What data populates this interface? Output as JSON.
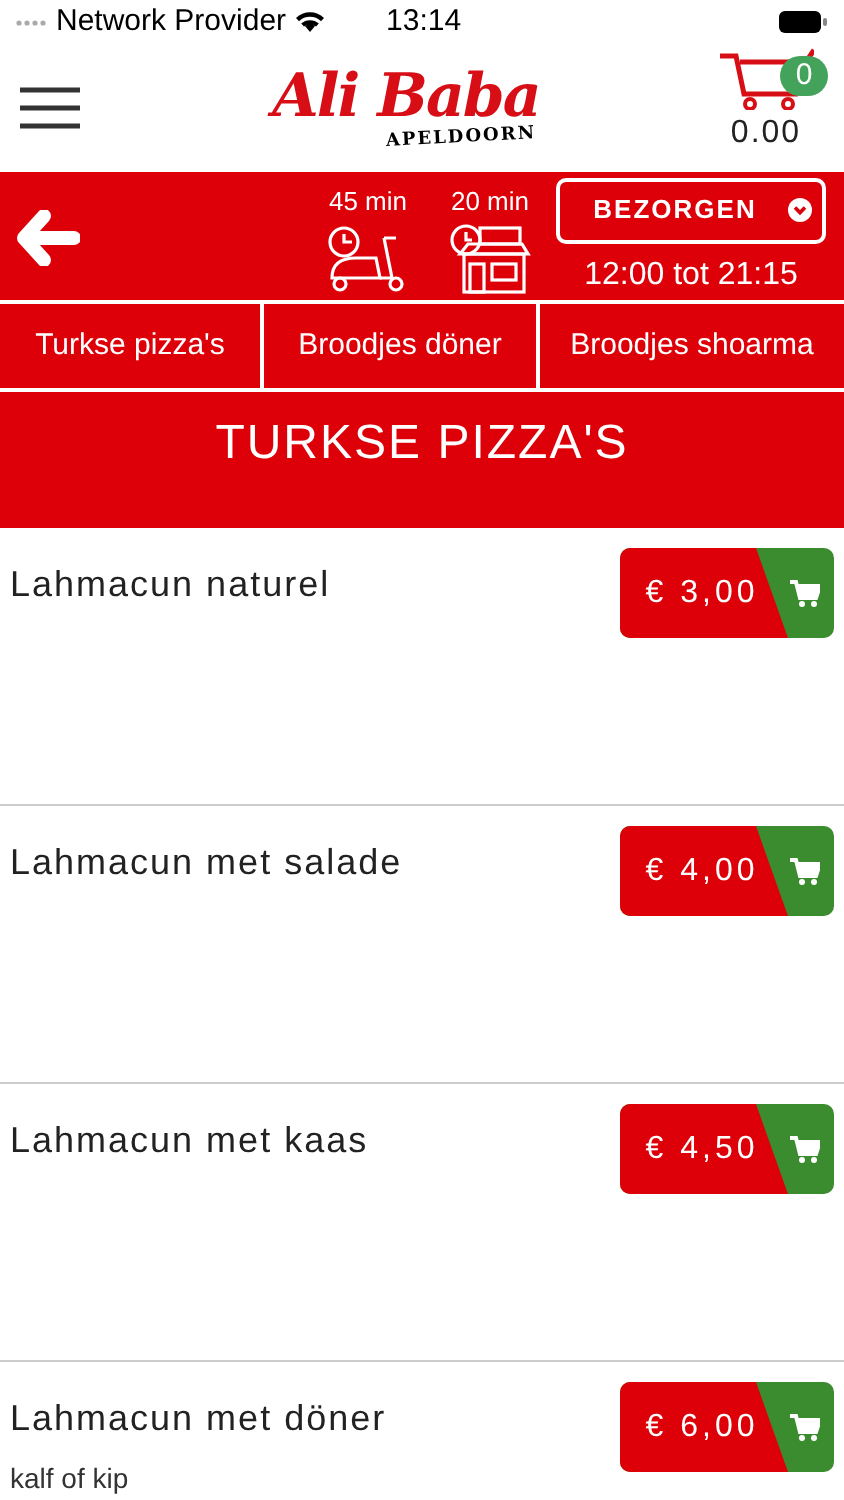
{
  "status_bar": {
    "carrier": "Network Provider",
    "time": "13:14"
  },
  "header": {
    "logo": "Ali Baba",
    "logo_sub": "APELDOORN",
    "cart_count": "0",
    "cart_total": "0.00"
  },
  "info_bar": {
    "delivery_time": "45 min",
    "pickup_time": "20 min",
    "mode": "BEZORGEN",
    "hours": "12:00 tot 21:15"
  },
  "categories": [
    {
      "label": "Turkse pizza's"
    },
    {
      "label": "Broodjes döner"
    },
    {
      "label": "Broodjes shoarma"
    }
  ],
  "section_title": "TURKSE PIZZA'S",
  "products": [
    {
      "name": "Lahmacun naturel",
      "price": "€ 3,00"
    },
    {
      "name": "Lahmacun met salade",
      "price": "€ 4,00"
    },
    {
      "name": "Lahmacun met kaas",
      "price": "€ 4,50"
    },
    {
      "name": "Lahmacun met döner",
      "description": "kalf of kip",
      "price": "€ 6,00"
    }
  ]
}
